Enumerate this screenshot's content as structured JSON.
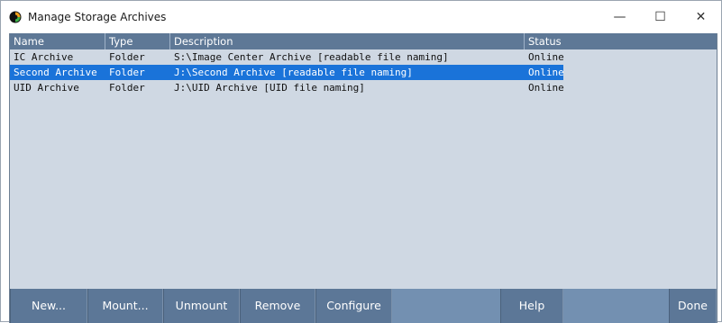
{
  "window": {
    "title": "Manage Storage Archives",
    "controls": {
      "minimize": "—",
      "maximize": "☐",
      "close": "✕"
    }
  },
  "grid": {
    "columns": [
      "Name",
      "Type",
      "Description",
      "Status"
    ],
    "rows": [
      {
        "name": "IC Archive",
        "type": "Folder",
        "description": "S:\\Image Center Archive [readable file naming]",
        "status": "Online",
        "selected": false
      },
      {
        "name": "Second Archive",
        "type": "Folder",
        "description": "J:\\Second Archive [readable file naming]",
        "status": "Online",
        "selected": true
      },
      {
        "name": "UID Archive",
        "type": "Folder",
        "description": "J:\\UID Archive [UID file naming]",
        "status": "Online",
        "selected": false
      }
    ]
  },
  "buttons": {
    "new": "New...",
    "mount": "Mount...",
    "unmount": "Unmount",
    "remove": "Remove",
    "configure": "Configure",
    "help": "Help",
    "done": "Done"
  },
  "colors": {
    "header_bg": "#5e7896",
    "selection": "#1a73d9",
    "grid_bg": "#cfd8e3"
  }
}
